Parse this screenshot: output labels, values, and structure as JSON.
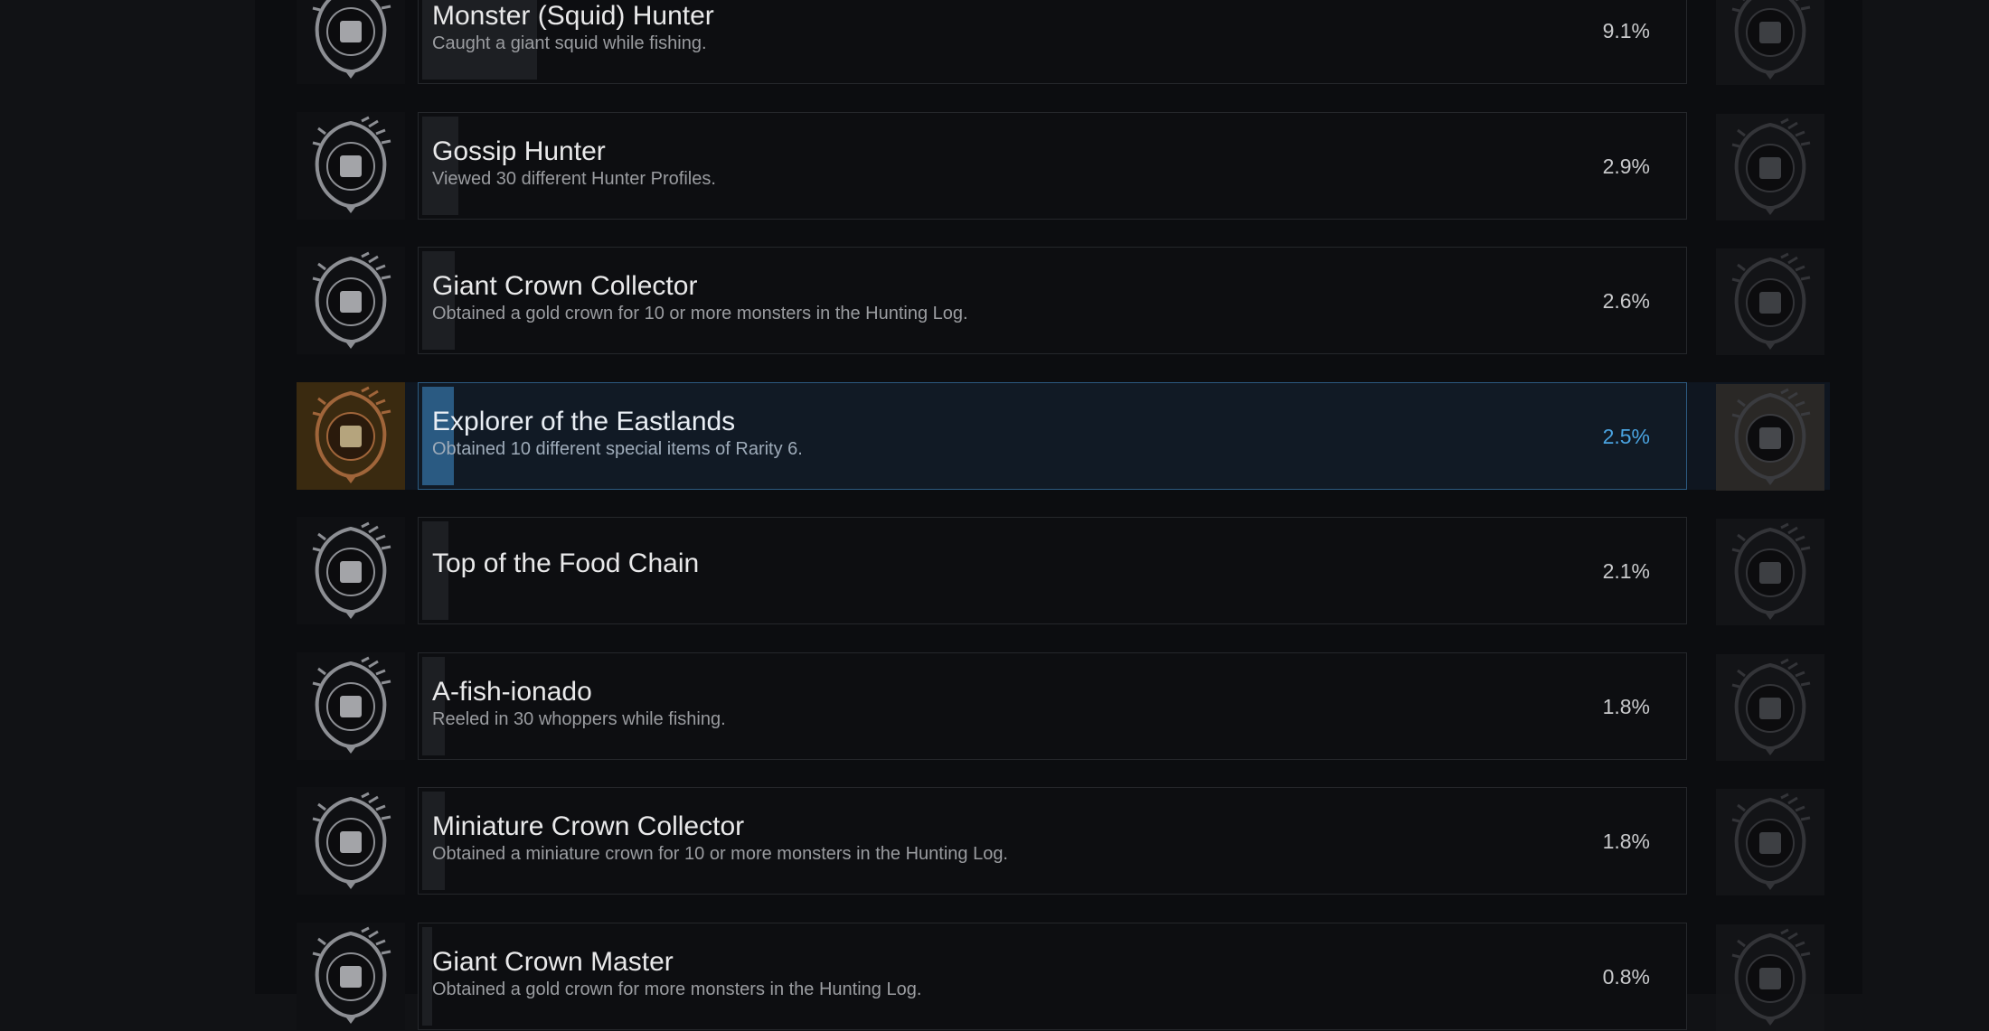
{
  "achievements": [
    {
      "title": "Monster (Squid) Hunter",
      "description": "Caught a giant squid while fishing.",
      "percent_label": "9.1%",
      "percent": 9.1,
      "icon": "squid-emblem-icon",
      "highlighted": false
    },
    {
      "title": "Gossip Hunter",
      "description": "Viewed 30 different Hunter Profiles.",
      "percent_label": "2.9%",
      "percent": 2.9,
      "icon": "profile-cards-emblem-icon",
      "highlighted": false
    },
    {
      "title": "Giant Crown Collector",
      "description": "Obtained a gold crown for 10 or more monsters in the Hunting Log.",
      "percent_label": "2.6%",
      "percent": 2.6,
      "icon": "crown-emblem-icon",
      "highlighted": false
    },
    {
      "title": "Explorer of the Eastlands",
      "description": "Obtained 10 different special items of Rarity 6.",
      "percent_label": "2.5%",
      "percent": 2.5,
      "icon": "scroll-quill-emblem-icon",
      "highlighted": true
    },
    {
      "title": "Top of the Food Chain",
      "description": "",
      "percent_label": "2.1%",
      "percent": 2.1,
      "icon": "compass-emblem-icon",
      "highlighted": false
    },
    {
      "title": "A-fish-ionado",
      "description": "Reeled in 30 whoppers while fishing.",
      "percent_label": "1.8%",
      "percent": 1.8,
      "icon": "fish-emblem-icon",
      "highlighted": false
    },
    {
      "title": "Miniature Crown Collector",
      "description": "Obtained a miniature crown for 10 or more monsters in the Hunting Log.",
      "percent_label": "1.8%",
      "percent": 1.8,
      "icon": "crown-emblem-icon",
      "highlighted": false
    },
    {
      "title": "Giant Crown Master",
      "description": "Obtained a gold crown for more monsters in the Hunting Log.",
      "percent_label": "0.8%",
      "percent": 0.8,
      "icon": "crown-emblem-icon",
      "highlighted": false
    }
  ],
  "colors": {
    "highlight_accent": "#4aa3e0",
    "highlight_border": "#2c5a80",
    "icon_gold": "#8a5a2a"
  }
}
